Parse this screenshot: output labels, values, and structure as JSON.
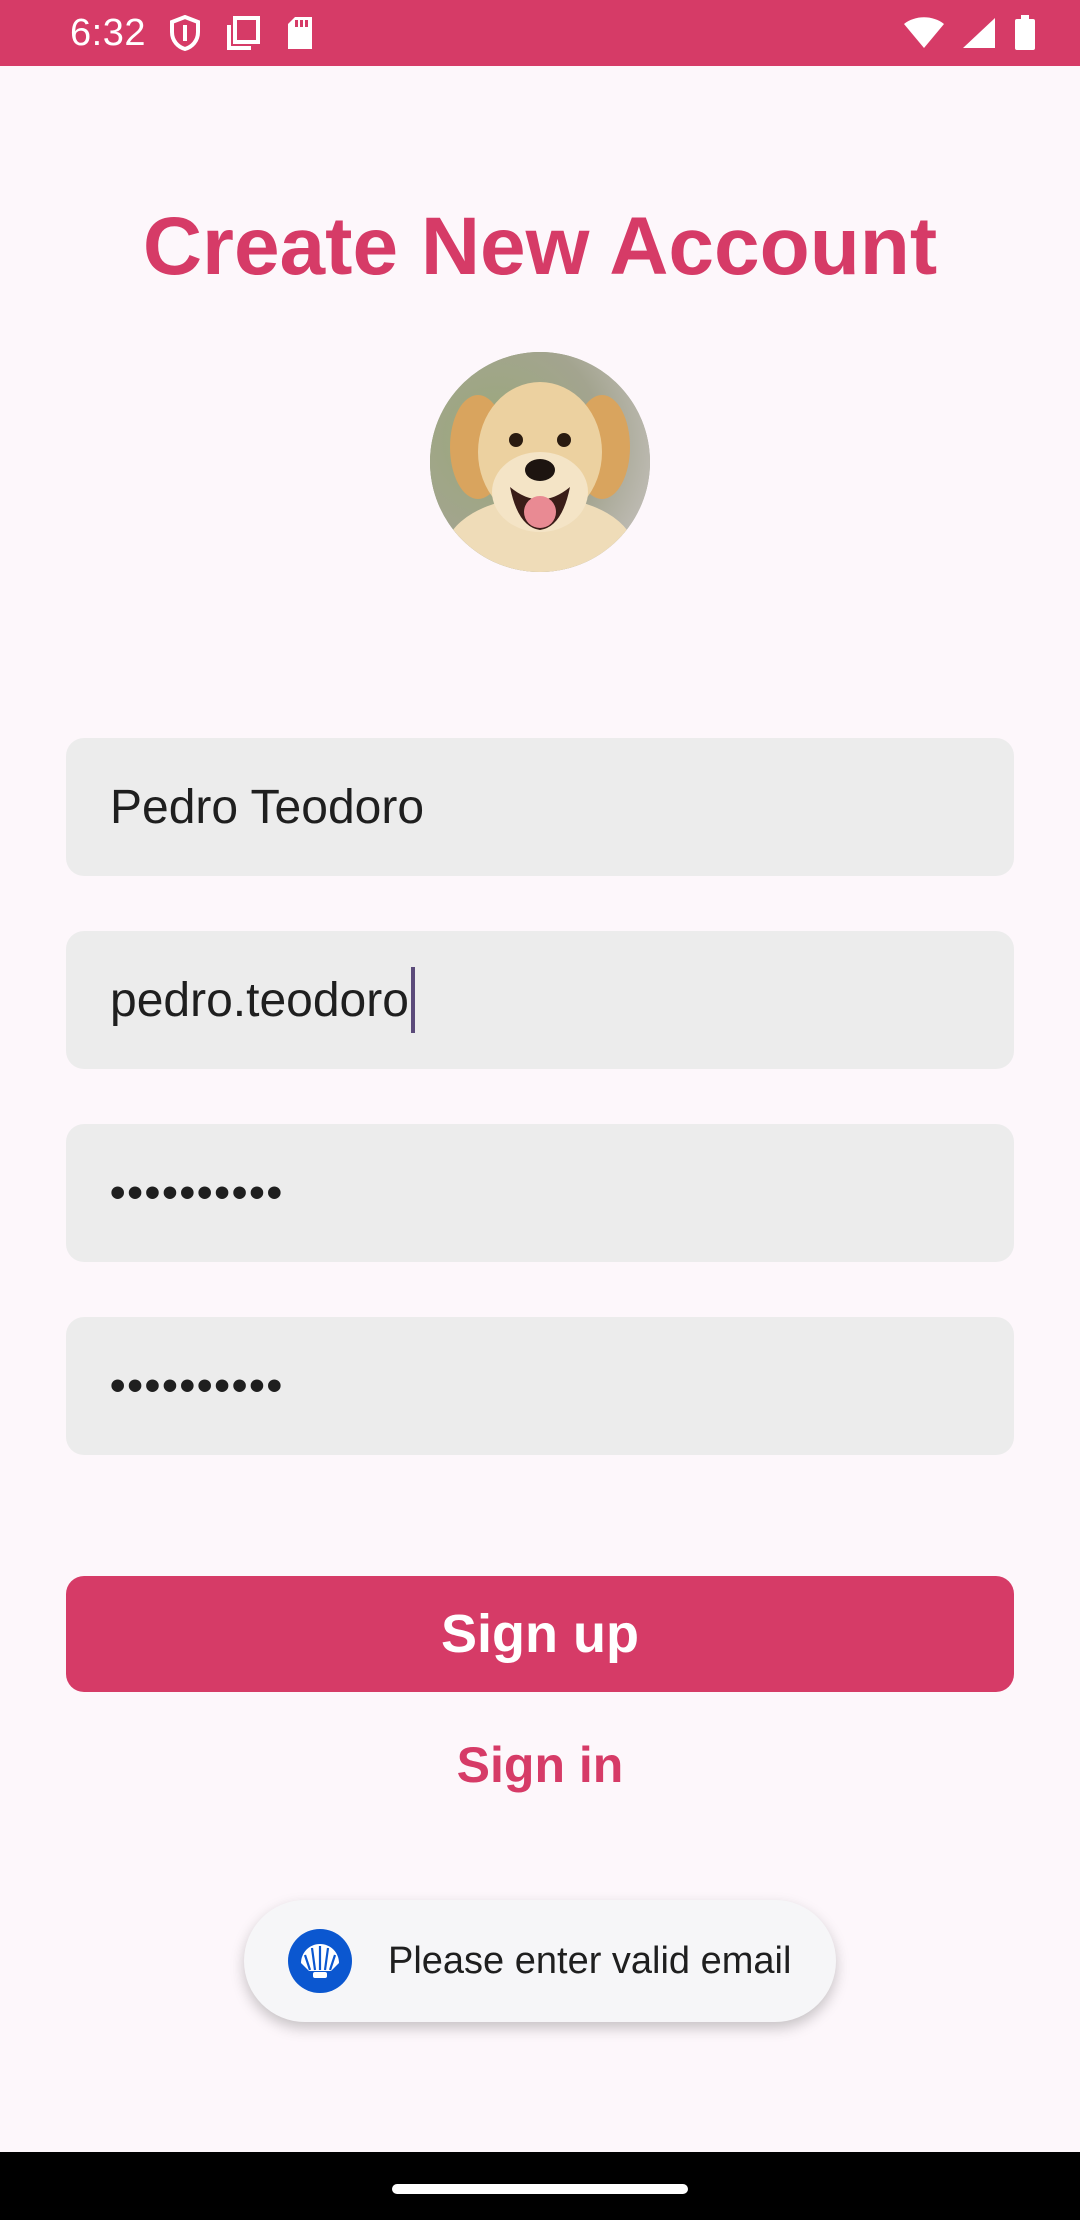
{
  "status_bar": {
    "time": "6:32",
    "left_icons": [
      "shield-icon",
      "copy-icon",
      "sd-card-icon"
    ],
    "right_icons": [
      "wifi-icon",
      "signal-icon",
      "battery-icon"
    ],
    "color": "#d63b67"
  },
  "header": {
    "title": "Create New Account"
  },
  "avatar": {
    "icon": "dog-photo"
  },
  "form": {
    "name_value": "Pedro Teodoro",
    "email_value": "pedro.teodoro",
    "password_value": "••••••••••",
    "confirm_password_value": "••••••••••"
  },
  "actions": {
    "signup_label": "Sign up",
    "signin_label": "Sign in"
  },
  "toast": {
    "icon": "app-shell-icon",
    "message": "Please enter valid email"
  },
  "colors": {
    "accent": "#d63b67",
    "background": "#fdf7fb",
    "field_bg": "#ececec"
  }
}
